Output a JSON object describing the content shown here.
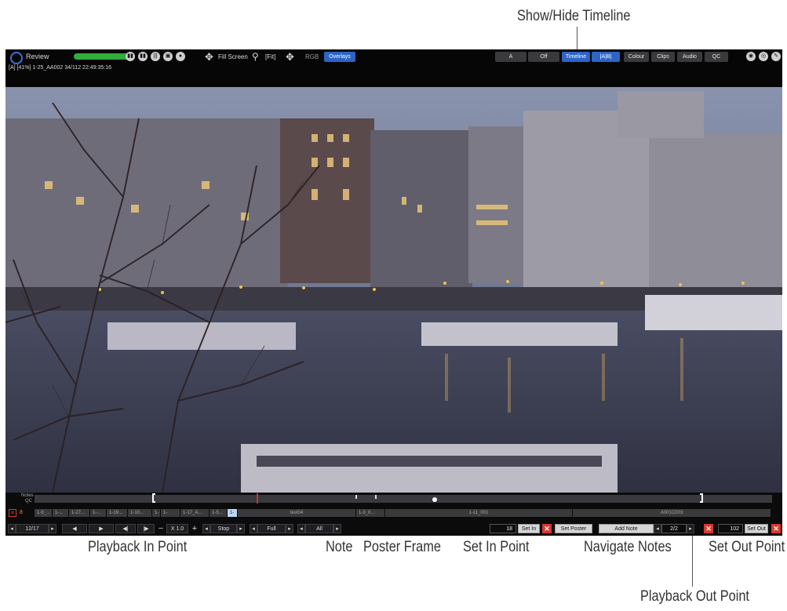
{
  "callouts": {
    "show_hide_timeline": "Show/Hide Timeline",
    "playback_in_point": "Playback In Point",
    "note": "Note",
    "poster_frame": "Poster Frame",
    "set_in_point": "Set In Point",
    "navigate_notes": "Navigate Notes",
    "set_out_point": "Set Out Point",
    "playback_out_point": "Playback Out Point"
  },
  "topbar": {
    "mode": "Review",
    "status_line": "[A] [41%]  1-25_AA002  34/112  22:49:35:16",
    "fill_screen": "Fill Screen",
    "fit": "[Fit]",
    "rgb": "RGB",
    "overlays": "Overlays",
    "compare_a": "A",
    "compare_off": "Off",
    "timeline": "Timeline",
    "ab": "|A|B|",
    "colour": "Colour",
    "clips": "Clips",
    "audio": "Audio",
    "qc": "QC"
  },
  "timeline": {
    "notes_label": "Notes",
    "qc_label": "QC",
    "clip_count": "8",
    "clips": [
      "1-9_...",
      "1-...",
      "1-27...",
      "1-...",
      "1-19...",
      "1-10...",
      "1-",
      "1-",
      "1-17_A...",
      "1-5...",
      "1-",
      "test04",
      "1-3_0...",
      "1-11_001",
      "A001C003"
    ]
  },
  "controls": {
    "clip_index": "12/17",
    "speed": "X 1.0",
    "loop_mode": "Stop",
    "range_mode": "Full",
    "scope": "All",
    "in_frame": "18",
    "set_in": "Set In",
    "set_poster": "Set Poster",
    "add_note": "Add Note",
    "note_index": "2/2",
    "out_frame": "102",
    "set_out": "Set Out"
  },
  "colors": {
    "accent_blue": "#2c64c8",
    "record_green": "#2fae3b",
    "close_red": "#d83a2f",
    "playhead_red": "#c0392b"
  }
}
